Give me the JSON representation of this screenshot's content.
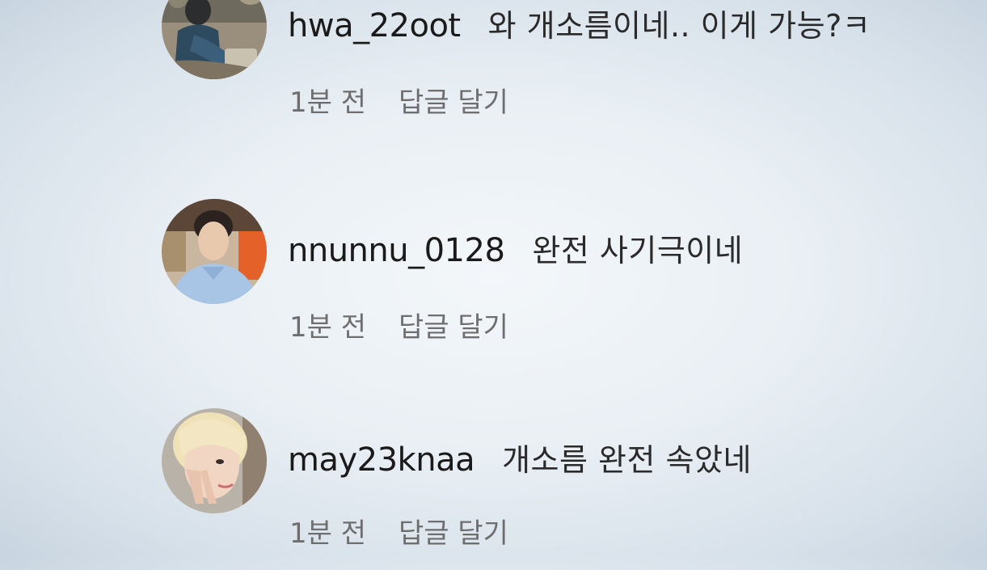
{
  "comments": [
    {
      "username": "hwa_22oot",
      "text": "와 개소름이네.. 이게 가능?ㅋ",
      "time": "1분 전",
      "reply_label": "답글 달기",
      "avatar_icon": "profile-photo-sitting-person"
    },
    {
      "username": "nnunnu_0128",
      "text": "완전 사기극이네",
      "time": "1분 전",
      "reply_label": "답글 달기",
      "avatar_icon": "profile-photo-man-blue-shirt"
    },
    {
      "username": "may23knaa",
      "text": "개소름 완전 속았네",
      "time": "1분 전",
      "reply_label": "답글 달기",
      "avatar_icon": "profile-photo-blonde-woman-peace-sign"
    }
  ],
  "colors": {
    "text_primary": "#1a1a1a",
    "text_secondary": "#6e6e6e",
    "background": "#e9eff4"
  }
}
